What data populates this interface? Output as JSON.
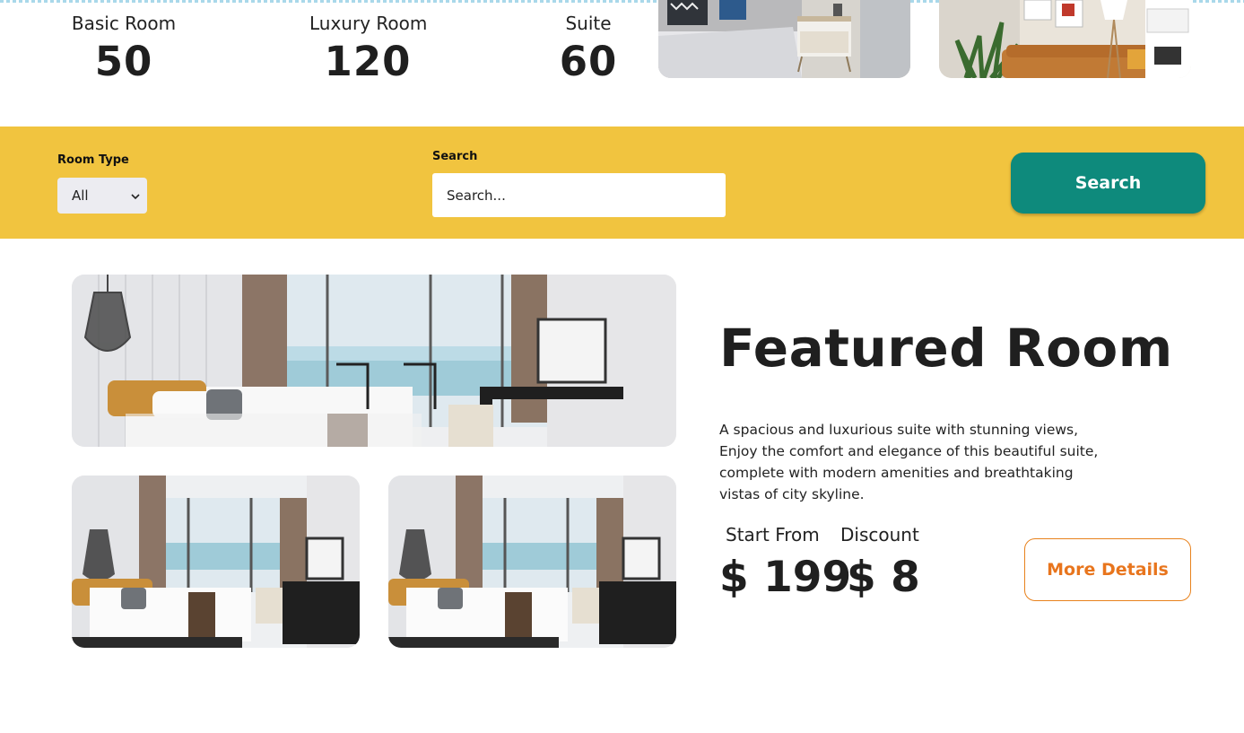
{
  "stats": [
    {
      "label": "Basic Room",
      "value": "50"
    },
    {
      "label": "Luxury Room",
      "value": "120"
    },
    {
      "label": "Suite",
      "value": "60"
    }
  ],
  "filter": {
    "room_type_label": "Room Type",
    "room_type_value": "All",
    "search_label": "Search",
    "search_placeholder": "Search...",
    "search_button": "Search"
  },
  "featured": {
    "title": "Featured Room",
    "description": "A spacious and luxurious suite with stunning views, Enjoy the comfort and elegance of this beautiful suite, complete with modern amenities and breathtaking vistas of city skyline.",
    "start_from_label": "Start From",
    "start_from_value": "$ 199",
    "discount_label": "Discount",
    "discount_value": "$ 8",
    "more_button": "More Details"
  },
  "colors": {
    "band": "#f1c43f",
    "search_button": "#0e8a7c",
    "more_button": "#e8751d"
  }
}
